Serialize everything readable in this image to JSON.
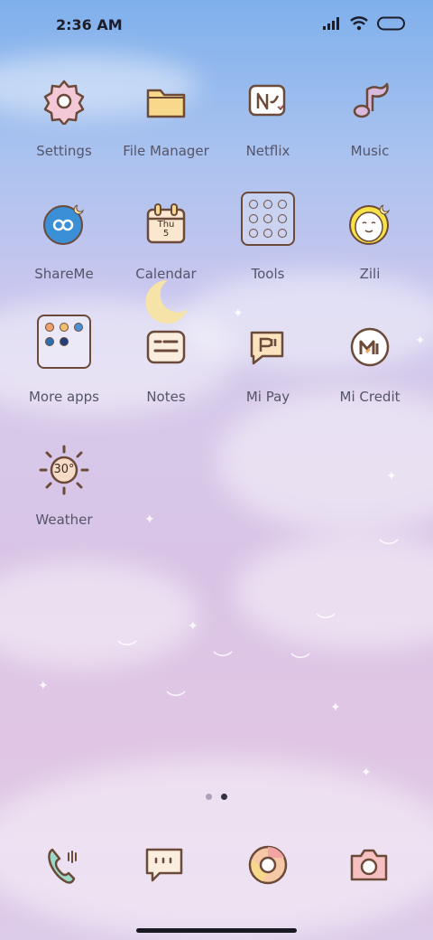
{
  "status_bar": {
    "time": "2:36 AM",
    "icons": [
      "signal-icon",
      "wifi-icon",
      "battery-icon"
    ]
  },
  "apps": [
    {
      "label": "Settings",
      "icon": "settings-gear-icon"
    },
    {
      "label": "File Manager",
      "icon": "folder-icon"
    },
    {
      "label": "Netflix",
      "icon": "netflix-icon"
    },
    {
      "label": "Music",
      "icon": "music-note-icon"
    },
    {
      "label": "ShareMe",
      "icon": "shareme-icon"
    },
    {
      "label": "Calendar",
      "icon": "calendar-icon",
      "day": "Thu",
      "date": "5"
    },
    {
      "label": "Tools",
      "icon": "tools-folder-icon"
    },
    {
      "label": "Zili",
      "icon": "zili-icon"
    },
    {
      "label": "More apps",
      "icon": "more-apps-folder-icon"
    },
    {
      "label": "Notes",
      "icon": "notes-icon"
    },
    {
      "label": "Mi Pay",
      "icon": "mi-pay-icon"
    },
    {
      "label": "Mi Credit",
      "icon": "mi-credit-icon"
    },
    {
      "label": "Weather",
      "icon": "weather-sun-icon",
      "temp": "30°"
    }
  ],
  "page_indicator": {
    "count": 2,
    "active": 1
  },
  "dock": [
    {
      "name": "phone",
      "icon": "phone-icon"
    },
    {
      "name": "messages",
      "icon": "messages-icon"
    },
    {
      "name": "browser",
      "icon": "chrome-icon"
    },
    {
      "name": "camera",
      "icon": "camera-icon"
    }
  ],
  "colors": {
    "icon_stroke": "#6b4a3a",
    "label": "#555468",
    "sky_top": "#7fb0ec",
    "sky_bottom": "#dccbe9"
  }
}
